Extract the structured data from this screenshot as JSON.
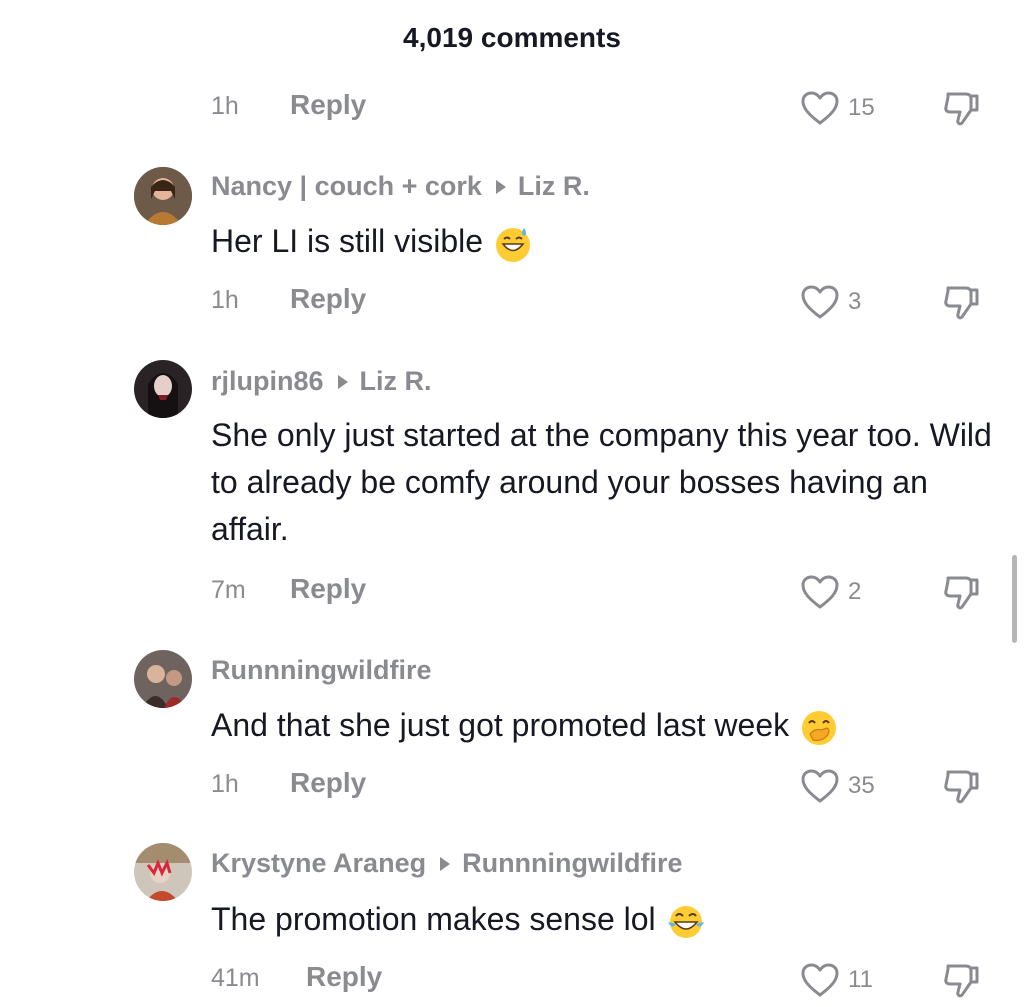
{
  "header": {
    "title": "4,019 comments"
  },
  "reply_label": "Reply",
  "top_row": {
    "time": "1h",
    "likes": "15"
  },
  "comments": [
    {
      "username": "Nancy | couch + cork",
      "reply_to": "Liz R.",
      "text": "Her LI is still visible",
      "emoji": "grinning-sweat-emoji",
      "time": "1h",
      "likes": "3"
    },
    {
      "username": "rjlupin86",
      "reply_to": "Liz R.",
      "text": "She only just started at the company this year too. Wild to already be comfy around your bosses having an affair.",
      "time": "7m",
      "likes": "2"
    },
    {
      "username": "Runnningwildfire",
      "text": "And that she just got promoted last week",
      "emoji": "hand-over-mouth-emoji",
      "time": "1h",
      "likes": "35"
    },
    {
      "username": "Krystyne Araneg",
      "reply_to": "Runnningwildfire",
      "text": "The promotion makes sense lol",
      "emoji": "tears-of-joy-emoji",
      "time": "41m",
      "likes": "11"
    }
  ],
  "colors": {
    "text": "#161823",
    "muted": "#8a8b91",
    "background": "#ffffff"
  }
}
